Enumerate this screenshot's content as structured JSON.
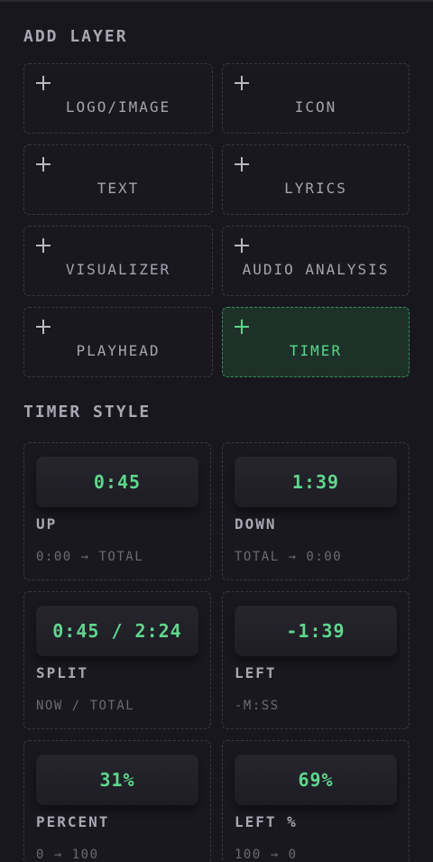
{
  "add_layer": {
    "title": "ADD LAYER",
    "items": [
      {
        "label": "LOGO/IMAGE"
      },
      {
        "label": "ICON"
      },
      {
        "label": "TEXT"
      },
      {
        "label": "LYRICS"
      },
      {
        "label": "VISUALIZER"
      },
      {
        "label": "AUDIO ANALYSIS"
      },
      {
        "label": "PLAYHEAD"
      },
      {
        "label": "TIMER",
        "active": true
      }
    ]
  },
  "timer_style": {
    "title": "TIMER STYLE",
    "items": [
      {
        "preview": "0:45",
        "name": "UP",
        "desc": "0:00 → TOTAL"
      },
      {
        "preview": "1:39",
        "name": "DOWN",
        "desc": "TOTAL → 0:00"
      },
      {
        "preview": "0:45 / 2:24",
        "name": "SPLIT",
        "desc": "NOW / TOTAL"
      },
      {
        "preview": "-1:39",
        "name": "LEFT",
        "desc": "-M:SS"
      },
      {
        "preview": "31%",
        "name": "PERCENT",
        "desc": "0 → 100"
      },
      {
        "preview": "69%",
        "name": "LEFT %",
        "desc": "100 → 0"
      }
    ]
  },
  "colors": {
    "background": "#18171e",
    "accent": "#56d98a",
    "active_bg": "#1d3129"
  },
  "icons": {
    "add": "plus-icon"
  }
}
